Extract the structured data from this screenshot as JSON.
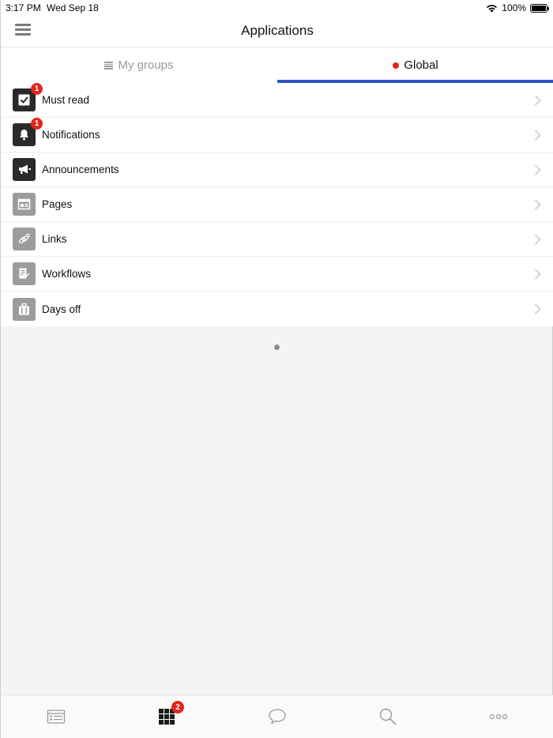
{
  "status_bar": {
    "time": "3:17 PM",
    "date": "Wed Sep 18",
    "battery": "100%"
  },
  "navbar": {
    "title": "Applications",
    "menu_icon": "hamburger-icon"
  },
  "tabs": [
    {
      "label": "My groups",
      "icon": "list-icon",
      "active": false
    },
    {
      "label": "Global",
      "icon": "red-dot-icon",
      "active": true
    }
  ],
  "apps": [
    {
      "label": "Must read",
      "icon": "checkbox-icon",
      "style": "dark",
      "badge": "1"
    },
    {
      "label": "Notifications",
      "icon": "bell-icon",
      "style": "dark",
      "badge": "1"
    },
    {
      "label": "Announcements",
      "icon": "megaphone-icon",
      "style": "dark",
      "badge": ""
    },
    {
      "label": "Pages",
      "icon": "page-icon",
      "style": "gray",
      "badge": ""
    },
    {
      "label": "Links",
      "icon": "link-icon",
      "style": "gray",
      "badge": ""
    },
    {
      "label": "Workflows",
      "icon": "workflow-icon",
      "style": "gray",
      "badge": ""
    },
    {
      "label": "Days off",
      "icon": "suitcase-icon",
      "style": "gray",
      "badge": ""
    }
  ],
  "tab_bar": {
    "items": [
      {
        "icon": "news-feed-icon"
      },
      {
        "icon": "apps-grid-icon",
        "badge": "2",
        "active": true
      },
      {
        "icon": "chat-bubble-icon"
      },
      {
        "icon": "search-icon"
      },
      {
        "icon": "more-icon"
      }
    ]
  },
  "colors": {
    "accent": "#2f55c2",
    "badge": "#e0271b",
    "dark_icon": "#2a2a2a",
    "gray_icon": "#9c9c9c"
  }
}
